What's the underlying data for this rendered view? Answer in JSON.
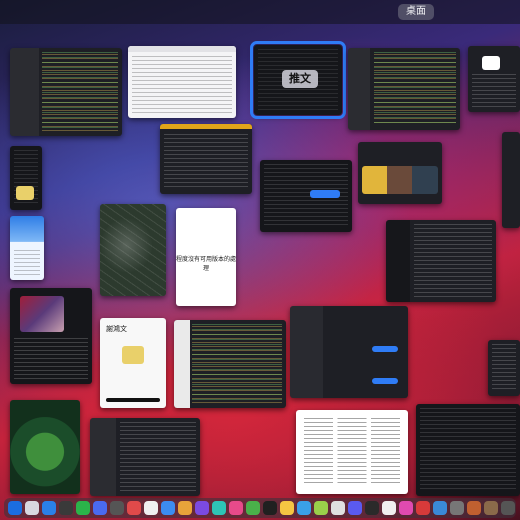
{
  "space": {
    "label": "桌面"
  },
  "selected_window": {
    "label": "推文"
  },
  "document_window": {
    "text": "程度沒有可用版本的處理"
  },
  "chat_window": {
    "heading": "謝鴻文"
  },
  "colors": {
    "selection": "#2f7cf6",
    "dock_background": "#3c323c",
    "wallpaper_red": "#c0223c",
    "wallpaper_blue": "#3a2a7a"
  }
}
